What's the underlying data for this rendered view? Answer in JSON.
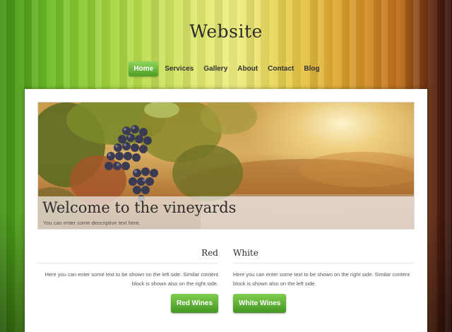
{
  "site": {
    "title": "Website"
  },
  "nav": {
    "items": [
      {
        "label": "Home",
        "active": true
      },
      {
        "label": "Services",
        "active": false
      },
      {
        "label": "Gallery",
        "active": false
      },
      {
        "label": "About",
        "active": false
      },
      {
        "label": "Contact",
        "active": false
      },
      {
        "label": "Blog",
        "active": false
      }
    ]
  },
  "hero": {
    "title": "Welcome to the vineyards",
    "subtitle": "You can enter some descriptive text here."
  },
  "columns": {
    "left": {
      "heading": "Red",
      "text": "Here you can enter some text to be shown on the left side. Similar content block is shown also on the right side.",
      "button": "Red Wines"
    },
    "right": {
      "heading": "White",
      "text": "Here you can enter some text to be shown on the right side. Similar content block is shown also on the left side.",
      "button": "White Wines"
    }
  },
  "colors": {
    "accent_green": "#5aab2e",
    "background_left": "#72c028",
    "background_right": "#2e0c08"
  }
}
